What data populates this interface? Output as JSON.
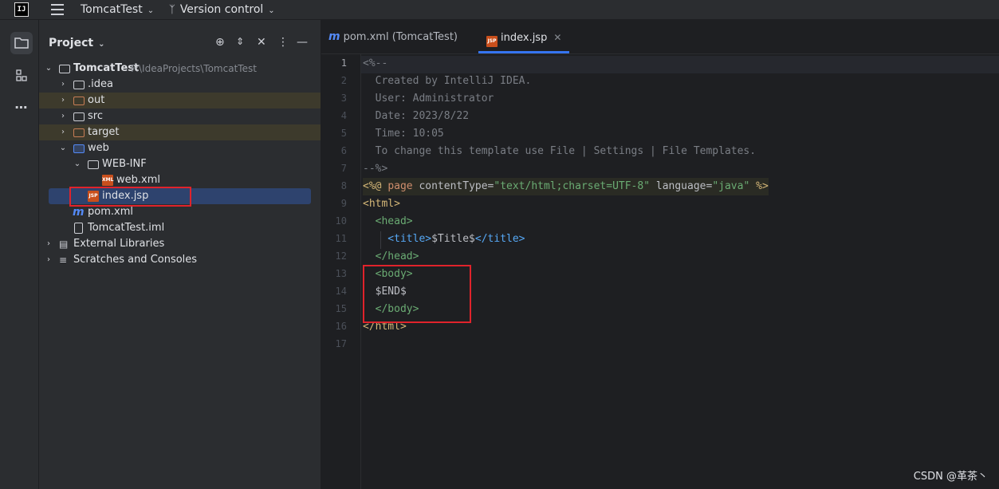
{
  "topbar": {
    "logo": "IJ",
    "project": "TomcatTest",
    "vcs": "Version control"
  },
  "toolstrip": {
    "icons": [
      "folder-icon",
      "structure-icon",
      "more-icon"
    ]
  },
  "project_panel": {
    "title": "Project",
    "tree": [
      {
        "label": "TomcatTest",
        "extra": "F:\\IdeaProjects\\TomcatTest"
      },
      {
        "label": ".idea"
      },
      {
        "label": "out"
      },
      {
        "label": "src"
      },
      {
        "label": "target"
      },
      {
        "label": "web"
      },
      {
        "label": "WEB-INF"
      },
      {
        "label": "web.xml"
      },
      {
        "label": "index.jsp"
      },
      {
        "label": "pom.xml"
      },
      {
        "label": "TomcatTest.iml"
      },
      {
        "label": "External Libraries"
      },
      {
        "label": "Scratches and Consoles"
      }
    ]
  },
  "editor": {
    "tabs": [
      {
        "label": "pom.xml (TomcatTest)"
      },
      {
        "label": "index.jsp"
      }
    ],
    "line_numbers": [
      "1",
      "2",
      "3",
      "4",
      "5",
      "6",
      "7",
      "8",
      "9",
      "10",
      "11",
      "12",
      "13",
      "14",
      "15",
      "16",
      "17"
    ],
    "code": {
      "l1": "<%--",
      "l2": "  Created by IntelliJ IDEA.",
      "l3": "  User: Administrator",
      "l4": "  Date: 2023/8/22",
      "l5": "  Time: 10:05",
      "l6": "  To change this template use File | Settings | File Templates.",
      "l7": "--%>",
      "l8_a": "<%@ ",
      "l8_b": "page ",
      "l8_c": "contentType",
      "l8_d": "=",
      "l8_e": "\"text/html;charset=UTF-8\"",
      "l8_f": " language",
      "l8_g": "=",
      "l8_h": "\"java\"",
      "l8_i": " %>",
      "l9": "<html>",
      "l10": "  <head>",
      "l11_a": "    <title>",
      "l11_b": "$Title$",
      "l11_c": "</title>",
      "l12": "  </head>",
      "l13": "  <body>",
      "l14": "  $END$",
      "l15": "  </body>",
      "l16": "</html>"
    }
  },
  "watermark": "CSDN @革茶丶"
}
